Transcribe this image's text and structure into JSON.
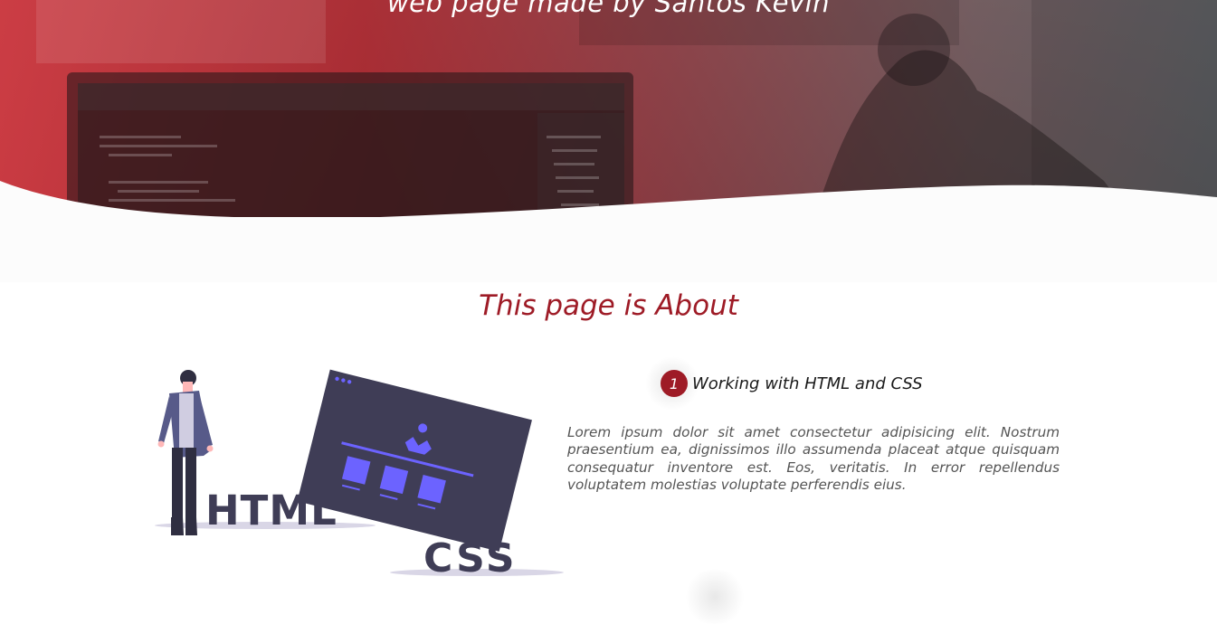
{
  "hero": {
    "subtitle": "web page made by Santos Kevin",
    "colors": {
      "gradient_start": "#cd343c",
      "gradient_end": "#4e5054"
    }
  },
  "about": {
    "title": "This page is About",
    "illustration": {
      "html_label": "HTML",
      "css_label": "CSS",
      "icon": "person-with-browser-window-illustration"
    },
    "feature": {
      "number": "1",
      "title": "Working with HTML and CSS",
      "text": "Lorem ipsum dolor sit amet consectetur adipisicing elit. Nostrum praesentium ea, dignissimos illo assumenda placeat atque quisquam consequatur inventore est. Eos, veritatis. In error repellendus voluptatem molestias voluptate perferendis eius."
    }
  },
  "colors": {
    "accent": "#9e1b26",
    "illustration_purple": "#6c63ff",
    "illustration_dark": "#3f3d56"
  }
}
